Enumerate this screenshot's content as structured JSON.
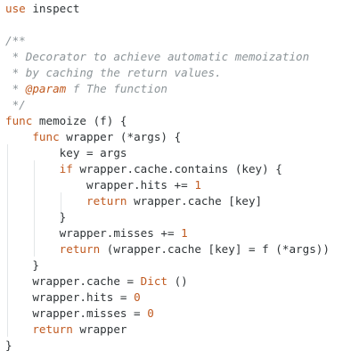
{
  "editor": {
    "lines": [
      [
        {
          "t": "use",
          "c": "kw"
        },
        {
          "t": " inspect",
          "c": "fn"
        }
      ],
      [],
      [
        {
          "t": "/**",
          "c": "cm"
        }
      ],
      [
        {
          "t": " * Decorator to achieve automatic memoization",
          "c": "cm"
        }
      ],
      [
        {
          "t": " * by caching the return values.",
          "c": "cm"
        }
      ],
      [
        {
          "t": " * ",
          "c": "cm"
        },
        {
          "t": "@param",
          "c": "tag"
        },
        {
          "t": " f The function",
          "c": "cm"
        }
      ],
      [
        {
          "t": " */",
          "c": "cm"
        }
      ],
      [
        {
          "t": "func",
          "c": "kw"
        },
        {
          "t": " memoize (f) {",
          "c": "fn"
        }
      ],
      [
        {
          "t": "    ",
          "c": "fn"
        },
        {
          "t": "func",
          "c": "kw"
        },
        {
          "t": " wrapper (*args) {",
          "c": "fn"
        }
      ],
      [
        {
          "t": "        key = args",
          "c": "fn"
        }
      ],
      [
        {
          "t": "        ",
          "c": "fn"
        },
        {
          "t": "if",
          "c": "kw"
        },
        {
          "t": " wrapper.cache.contains (key) {",
          "c": "fn"
        }
      ],
      [
        {
          "t": "            wrapper.hits += ",
          "c": "fn"
        },
        {
          "t": "1",
          "c": "num"
        }
      ],
      [
        {
          "t": "            ",
          "c": "fn"
        },
        {
          "t": "return",
          "c": "kw"
        },
        {
          "t": " wrapper.cache [key]",
          "c": "fn"
        }
      ],
      [
        {
          "t": "        }",
          "c": "fn"
        }
      ],
      [
        {
          "t": "        wrapper.misses += ",
          "c": "fn"
        },
        {
          "t": "1",
          "c": "num"
        }
      ],
      [
        {
          "t": "        ",
          "c": "fn"
        },
        {
          "t": "return",
          "c": "kw"
        },
        {
          "t": " (wrapper.cache [key] = f (*args))",
          "c": "fn"
        }
      ],
      [
        {
          "t": "    }",
          "c": "fn"
        }
      ],
      [
        {
          "t": "    wrapper.cache = ",
          "c": "fn"
        },
        {
          "t": "Dict",
          "c": "kw"
        },
        {
          "t": " ()",
          "c": "fn"
        }
      ],
      [
        {
          "t": "    wrapper.hits = ",
          "c": "fn"
        },
        {
          "t": "0",
          "c": "num"
        }
      ],
      [
        {
          "t": "    wrapper.misses = ",
          "c": "fn"
        },
        {
          "t": "0",
          "c": "num"
        }
      ],
      [
        {
          "t": "    ",
          "c": "fn"
        },
        {
          "t": "return",
          "c": "kw"
        },
        {
          "t": " wrapper",
          "c": "fn"
        }
      ],
      [
        {
          "t": "}",
          "c": "fn"
        }
      ]
    ]
  }
}
